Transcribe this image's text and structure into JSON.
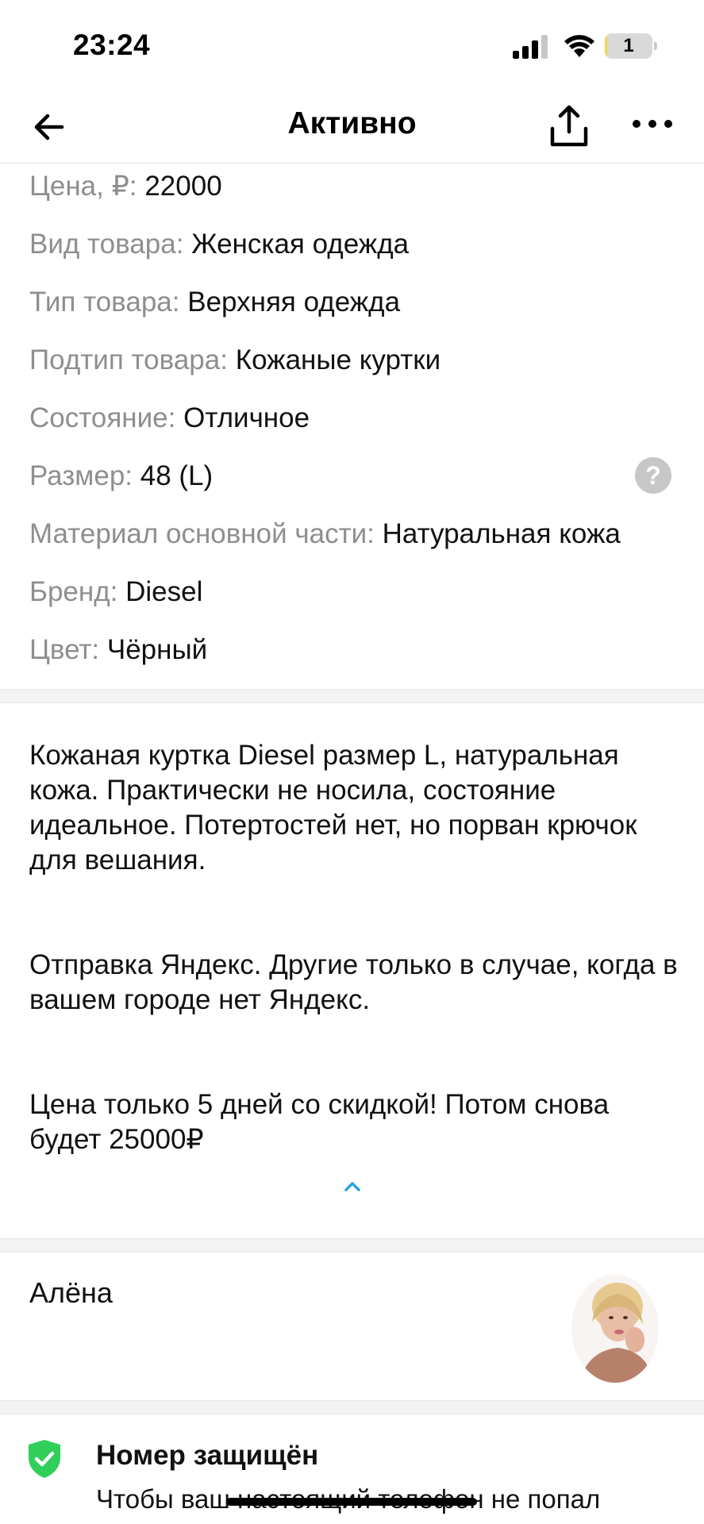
{
  "status_bar": {
    "time": "23:24",
    "battery_level": "1",
    "battery_fraction": 0.01,
    "icons": [
      "signal-icon",
      "wifi-icon",
      "battery-icon"
    ]
  },
  "nav": {
    "title": "Активно",
    "icons": [
      "arrow-left-icon",
      "share-icon",
      "more-icon"
    ]
  },
  "params": [
    {
      "key": "Цена, ₽:",
      "value": "22000"
    },
    {
      "key": "Вид товара:",
      "value": "Женская одежда"
    },
    {
      "key": "Тип товара:",
      "value": "Верхняя одежда"
    },
    {
      "key": "Подтип товара:",
      "value": "Кожаные куртки"
    },
    {
      "key": "Состояние:",
      "value": "Отличное"
    },
    {
      "key": "Размер:",
      "value": "48 (L)"
    },
    {
      "key": "Материал основной части:",
      "value": "Натуральная кожа"
    },
    {
      "key": "Бренд:",
      "value": "Diesel"
    },
    {
      "key": "Цвет:",
      "value": "Чёрный"
    }
  ],
  "help_label": "?",
  "description": {
    "paragraphs": [
      "Кожаная куртка Diesel размер L, натуральная кожа. Практически не носила, состояние идеальное. Потертостей нет, но порван крючок для вешания.",
      "Отправка Яндекс. Другие только в случае, когда в вашем городе нет Яндекс.",
      "Цена только 5 дней со скидкой! Потом снова будет 25000₽"
    ]
  },
  "seller": {
    "name": "Алёна"
  },
  "protection": {
    "title": "Номер защищён",
    "text": "Чтобы ваш настоящий телефон не попал"
  },
  "colors": {
    "accent": "#2aa4e0",
    "shield": "#2fcf5a",
    "muted": "#8e8e8e"
  }
}
